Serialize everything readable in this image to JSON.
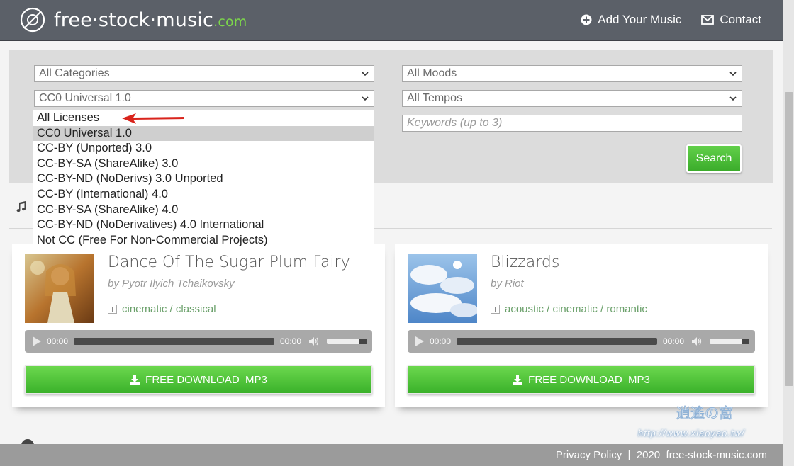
{
  "header": {
    "logo_text": "free·stock·music",
    "logo_tld": ".com",
    "nav": [
      {
        "label": "Add Your Music",
        "icon": "plus-circle-icon"
      },
      {
        "label": "Contact",
        "icon": "envelope-icon"
      }
    ]
  },
  "filters": {
    "category": "All Categories",
    "license": "CC0 Universal 1.0",
    "mood": "All Moods",
    "tempo": "All Tempos",
    "keywords_placeholder": "Keywords (up to 3)",
    "search_label": "Search"
  },
  "license_options": [
    "All Licenses",
    "CC0 Universal 1.0",
    "CC-BY (Unported) 3.0",
    "CC-BY-SA (ShareAlike) 3.0",
    "CC-BY-ND (NoDerivs) 3.0 Unported",
    "CC-BY (International) 4.0",
    "CC-BY-SA (ShareAlike) 4.0",
    "CC-BY-ND (NoDerivatives) 4.0 International",
    "Not CC (Free For Non-Commercial Projects)"
  ],
  "license_selected_index": 1,
  "tracks": [
    {
      "title": "Dance Of The Sugar Plum Fairy",
      "artist": "by Pyotr Ilyich Tchaikovsky",
      "tags": "cinematic / classical",
      "time_current": "00:00",
      "time_total": "00:00",
      "download_label": "FREE DOWNLOAD  MP3"
    },
    {
      "title": "Blizzards",
      "artist": "by Riot",
      "tags": "acoustic / cinematic / romantic",
      "time_current": "00:00",
      "time_total": "00:00",
      "download_label": "FREE DOWNLOAD  MP3"
    }
  ],
  "footer": {
    "text": "Privacy Policy  |  2020  free-stock-music.com"
  },
  "watermark": "http://www.xiaoyao.tw/",
  "colors": {
    "header_bg": "#5b6068",
    "accent_green": "#4cc236",
    "tld_green": "#7cd64b"
  }
}
